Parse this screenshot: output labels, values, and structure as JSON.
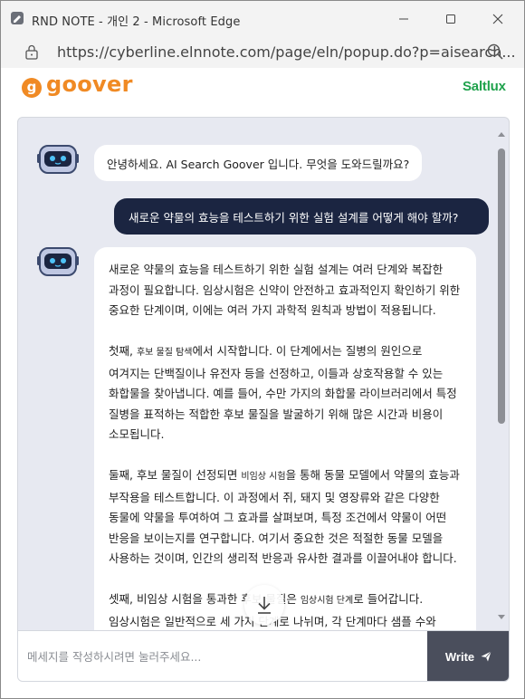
{
  "window": {
    "title": "RND NOTE - 개인 2 - Microsoft Edge"
  },
  "addressbar": {
    "url": "https://cyberline.elnnote.com/page/eln/popup.do?p=aisearch..."
  },
  "header": {
    "logo_letter": "g",
    "logo_text": "goover",
    "partner": "Saltlux"
  },
  "chat": {
    "greeting": "안녕하세요. AI Search Goover 입니다. 무엇을 도와드릴까요?",
    "user_question": "새로운 약물의 효능을 테스트하기 위한 실험 설계를 어떻게 해야 할까?",
    "answer": {
      "p1": "새로운 약물의 효능을 테스트하기 위한 실험 설계는 여러 단계와 복잡한 과정이 필요합니다. 임상시험은 신약이 안전하고 효과적인지 확인하기 위한 중요한 단계이며, 이에는 여러 가지 과학적 원칙과 방법이 적용됩니다.",
      "p2_pre": "첫째, ",
      "p2_tag": "후보 물질 탐색",
      "p2_post": "에서 시작합니다. 이 단계에서는 질병의 원인으로 여겨지는 단백질이나 유전자 등을 선정하고, 이들과 상호작용할 수 있는 화합물을 찾아냅니다. 예를 들어, 수만 가지의 화합물 라이브러리에서 특정 질병을 표적하는 적합한 후보 물질을 발굴하기 위해 많은 시간과 비용이 소모됩니다.",
      "p3_pre": "둘째, 후보 물질이 선정되면 ",
      "p3_tag": "비임상 시험",
      "p3_post": "을 통해 동물 모델에서 약물의 효능과 부작용을 테스트합니다. 이 과정에서 쥐, 돼지 및 영장류와 같은 다양한 동물에 약물을 투여하여 그 효과를 살펴보며, 특정 조건에서 약물이 어떤 반응을 보이는지를 연구합니다. 여기서 중요한 것은 적절한 동물 모델을 사용하는 것이며, 인간의 생리적 반응과 유사한 결과를 이끌어내야 합니다.",
      "p4_pre": "셋째, 비임상 시험을 통과한 후보 물질은 ",
      "p4_tag": "임상시험 단계",
      "p4_post": "로 들어갑니다. 임상시험은 일반적으로 세 가지 단계로 나뉘며, 각 단계마다 샘플 수와 참가자의 특성이 조정됩니다. 이 과정에서는 대상자의 연령, 건강 상태, 인종 차이 등"
    },
    "input_placeholder": "메세지를 작성하시려면 눌러주세요...",
    "send_label": "Write"
  },
  "colors": {
    "brand_orange": "#f08a24",
    "saltlux_green": "#1fa24c",
    "user_bubble": "#1b2541",
    "panel_bg": "#e7e9f1",
    "write_button": "#4a4e5c"
  },
  "icons": {
    "bot_avatar": "robot-icon",
    "download": "arrow-down-icon",
    "send": "paper-plane-icon"
  }
}
